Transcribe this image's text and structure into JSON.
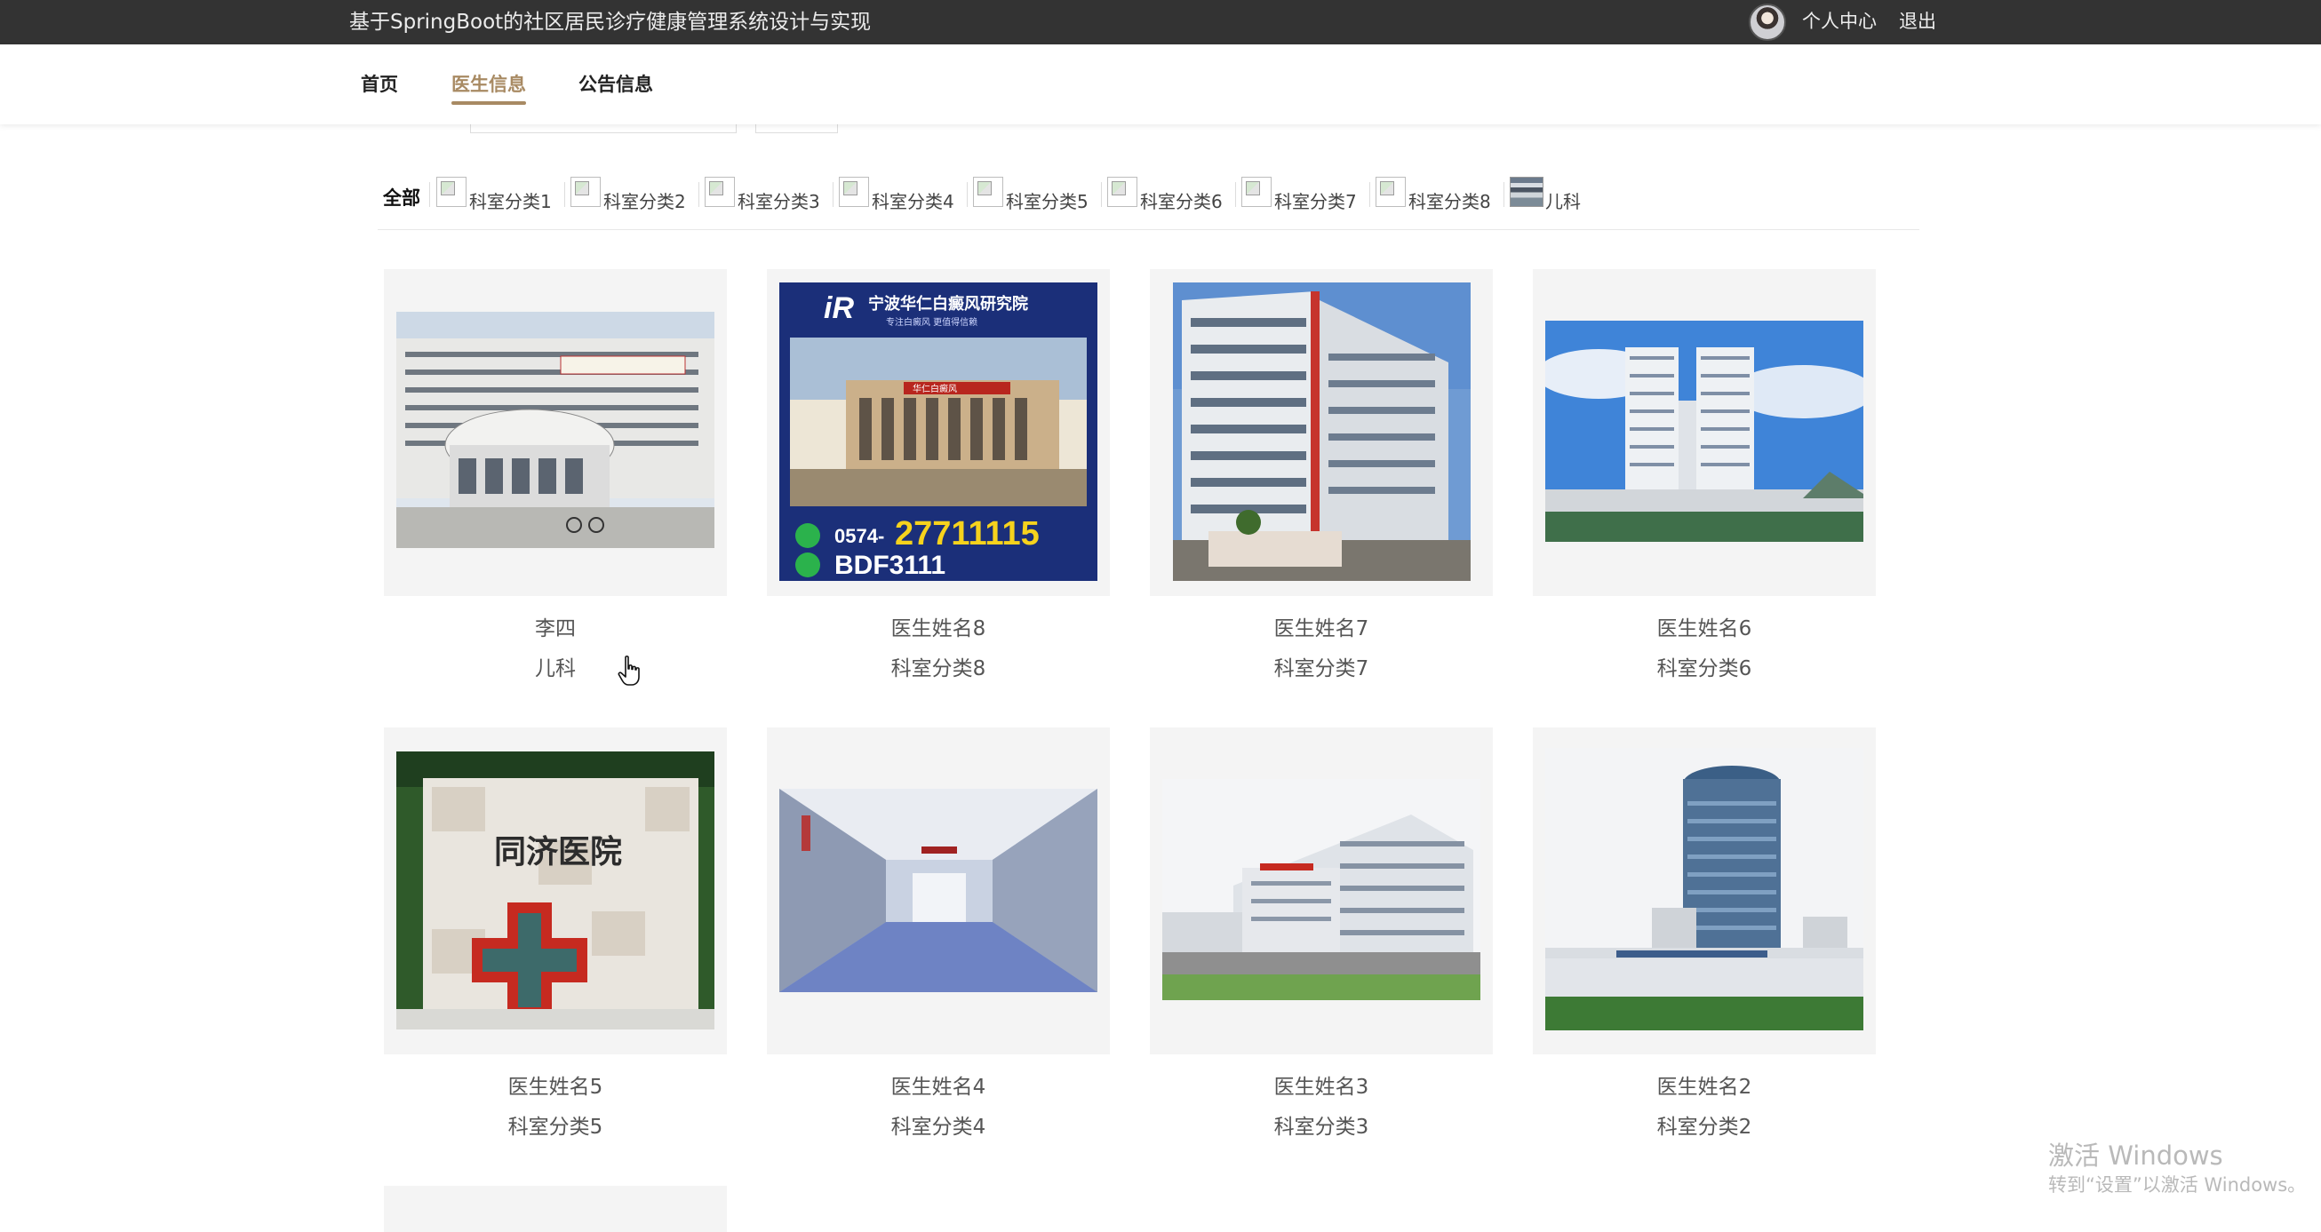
{
  "header": {
    "site_title": "基于SpringBoot的社区居民诊疗健康管理系统设计与实现",
    "user_center": "个人中心",
    "logout": "退出"
  },
  "nav": {
    "items": [
      {
        "label": "首页",
        "active": false
      },
      {
        "label": "医生信息",
        "active": true
      },
      {
        "label": "公告信息",
        "active": false
      }
    ],
    "accent_color": "#a88a63"
  },
  "categories": {
    "all_label": "全部",
    "items": [
      {
        "label": "科室分类1"
      },
      {
        "label": "科室分类2"
      },
      {
        "label": "科室分类3"
      },
      {
        "label": "科室分类4"
      },
      {
        "label": "科室分类5"
      },
      {
        "label": "科室分类6"
      },
      {
        "label": "科室分类7"
      },
      {
        "label": "科室分类8"
      },
      {
        "label": "儿科"
      }
    ]
  },
  "doctors": [
    {
      "name": "李四",
      "dept": "儿科",
      "photo": "hospital-building-photo"
    },
    {
      "name": "医生姓名8",
      "dept": "科室分类8",
      "photo": "hospital-advert-poster",
      "poster_title": "宁波华仁白癜风研究院",
      "poster_sub": "专注白癜风  更值得信赖",
      "poster_phone_prefix": "0574-",
      "poster_phone": "27711115",
      "poster_wechat": "BDF3111",
      "poster_sign": "华仁白癜风"
    },
    {
      "name": "医生姓名7",
      "dept": "科室分类7",
      "photo": "hospital-building-photo"
    },
    {
      "name": "医生姓名6",
      "dept": "科室分类6",
      "photo": "hospital-building-photo"
    },
    {
      "name": "医生姓名5",
      "dept": "科室分类5",
      "photo": "hospital-red-cross-photo"
    },
    {
      "name": "医生姓名4",
      "dept": "科室分类4",
      "photo": "hospital-corridor-photo"
    },
    {
      "name": "医生姓名3",
      "dept": "科室分类3",
      "photo": "hospital-building-photo"
    },
    {
      "name": "医生姓名2",
      "dept": "科室分类2",
      "photo": "hospital-tower-photo"
    }
  ],
  "watermark": {
    "line1": "激活 Windows",
    "line2": "转到“设置”以激活 Windows。"
  }
}
